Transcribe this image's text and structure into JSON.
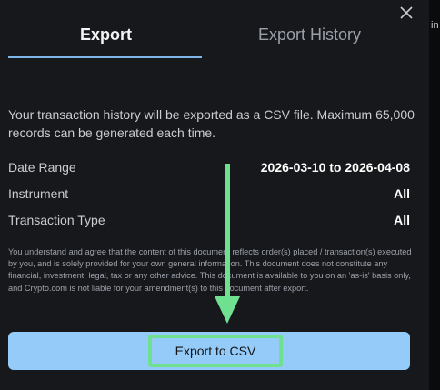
{
  "tabs": [
    {
      "label": "Export",
      "active": true
    },
    {
      "label": "Export History",
      "active": false
    }
  ],
  "intro_text": "Your transaction history will be exported as a CSV file. Maximum 65,000 records can be generated each time.",
  "fields": {
    "date_range": {
      "label": "Date Range",
      "value": "2026-03-10 to 2026-04-08"
    },
    "instrument": {
      "label": "Instrument",
      "value": "All"
    },
    "transaction_type": {
      "label": "Transaction Type",
      "value": "All"
    }
  },
  "disclaimer": "You understand and agree that the content of this document reflects order(s) placed / transaction(s) executed by you, and is solely provided for your own general information. This document does not constitute any financial, investment, legal, tax or any other advice. This document is available to you on an 'as-is' basis only, and Crypto.com is not liable for your amendment(s) to this document after export.",
  "export_button": {
    "label": "Export to CSV"
  },
  "icons": {
    "close": "close-icon",
    "annotation_arrow": "down-arrow-icon"
  },
  "sliver_text": "in",
  "colors": {
    "accent": "#7fb6ea",
    "button_bg": "#94cbf8",
    "highlight": "#6fe08f",
    "panel_bg": "#17181b"
  }
}
